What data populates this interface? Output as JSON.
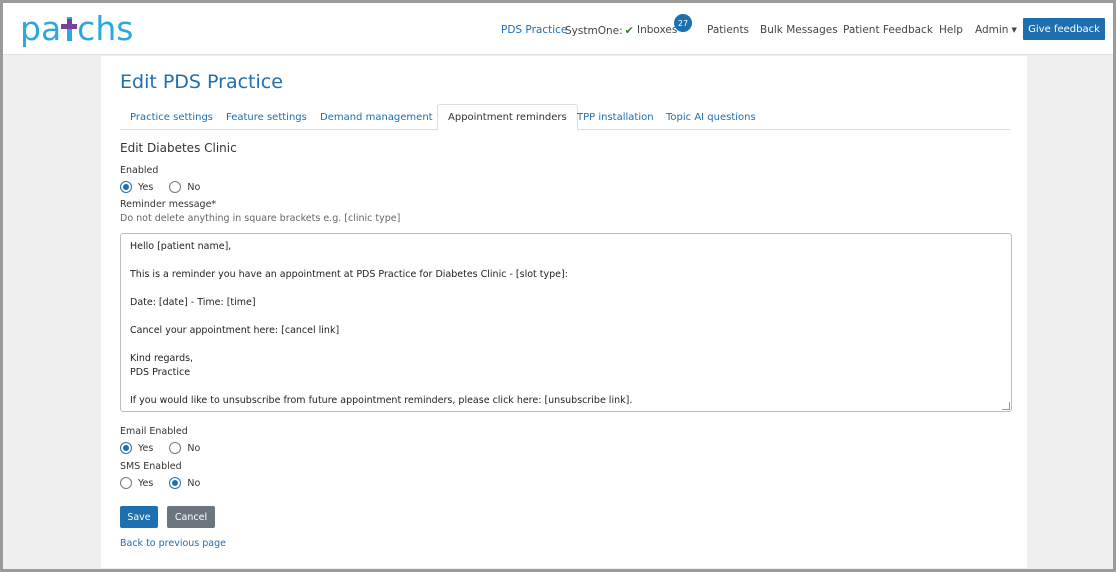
{
  "brand": {
    "logo_text_left": "pa",
    "logo_text_right": "chs",
    "primary_color": "#1d6fb0",
    "logo_color": "#29a9e0"
  },
  "nav": {
    "practice": "PDS Practice",
    "systmone": "SystmOne:",
    "inboxes": "Inboxes",
    "inbox_count": "27",
    "patients": "Patients",
    "bulk_messages": "Bulk Messages",
    "patient_feedback": "Patient Feedback",
    "help": "Help",
    "admin": "Admin",
    "give_feedback": "Give feedback"
  },
  "page": {
    "title": "Edit PDS Practice",
    "tabs": [
      {
        "label": "Practice settings"
      },
      {
        "label": "Feature settings"
      },
      {
        "label": "Demand management"
      },
      {
        "label": "Appointment reminders"
      },
      {
        "label": "TPP installation"
      },
      {
        "label": "Topic AI questions"
      }
    ],
    "active_tab": "Appointment reminders"
  },
  "form": {
    "section_title": "Edit Diabetes Clinic",
    "enabled_label": "Enabled",
    "yes": "Yes",
    "no": "No",
    "enabled_value": "Yes",
    "reminder_label": "Reminder message*",
    "reminder_hint": "Do not delete anything in square brackets e.g. [clinic type]",
    "message_lines": [
      "Hello [patient name],",
      "",
      "This is a reminder you have an appointment at PDS Practice for Diabetes Clinic - [slot type]:",
      "",
      "Date: [date] - Time: [time]",
      "",
      "Cancel your appointment here: [cancel link]",
      "",
      "Kind regards,",
      "PDS Practice",
      "",
      "If you would like to unsubscribe from future appointment reminders, please click here: [unsubscribe link]."
    ],
    "email_enabled_label": "Email Enabled",
    "email_enabled_value": "Yes",
    "sms_enabled_label": "SMS Enabled",
    "sms_enabled_value": "No",
    "save": "Save",
    "cancel": "Cancel",
    "back_link": "Back to previous page"
  }
}
